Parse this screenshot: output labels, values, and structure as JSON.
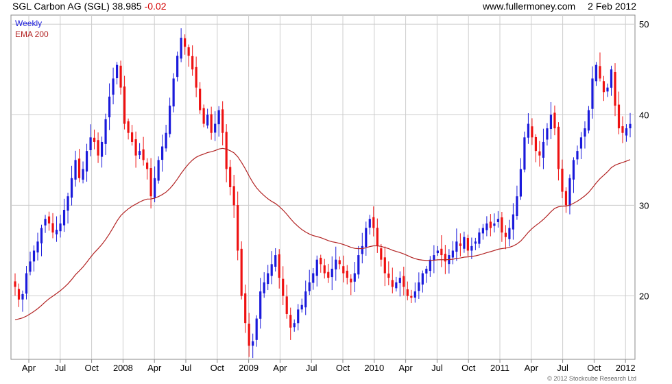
{
  "header": {
    "title": "SGL Carbon AG (SGL)",
    "last": "38.985",
    "change": "-0.02",
    "source": "www.fullermoney.com",
    "date": "2 Feb 2012"
  },
  "colors": {
    "up": "#1a1adb",
    "down": "#ee1111",
    "ema": "#b22222",
    "grid": "#cccccc",
    "frame": "#888888"
  },
  "chart_data": {
    "type": "candlestick",
    "interval": "Weekly",
    "overlay": "EMA 200",
    "x_tick_labels": [
      "Apr",
      "Jul",
      "Oct",
      "2008",
      "Apr",
      "Jul",
      "Oct",
      "2009",
      "Apr",
      "Jul",
      "Oct",
      "2010",
      "Apr",
      "Jul",
      "Oct",
      "2011",
      "Apr",
      "Jul",
      "Oct",
      "2012"
    ],
    "y_ticks": [
      20,
      30,
      40,
      50
    ],
    "ylim": [
      13,
      51
    ],
    "grid": true,
    "legend": "top-left",
    "copyright": "© 2012 Stockcube Research Ltd",
    "closes": [
      21.0,
      19.6,
      20.2,
      22.5,
      23.8,
      25.0,
      26.0,
      27.5,
      28.5,
      28.0,
      27.0,
      27.3,
      28.0,
      29.5,
      31.0,
      33.0,
      35.0,
      33.0,
      34.0,
      36.0,
      37.5,
      37.0,
      35.5,
      37.0,
      39.5,
      42.0,
      44.0,
      45.5,
      43.0,
      39.0,
      38.0,
      37.0,
      35.5,
      36.0,
      35.0,
      34.0,
      31.0,
      33.0,
      35.0,
      36.5,
      38.0,
      41.0,
      44.0,
      46.5,
      48.5,
      47.5,
      46.5,
      45.0,
      43.0,
      40.5,
      39.0,
      40.0,
      38.0,
      39.0,
      40.5,
      38.0,
      34.0,
      32.0,
      30.0,
      25.0,
      20.0,
      17.0,
      14.5,
      15.0,
      17.5,
      20.5,
      21.5,
      22.5,
      23.5,
      24.5,
      22.0,
      20.0,
      18.0,
      16.5,
      17.0,
      18.5,
      19.0,
      20.5,
      21.5,
      22.5,
      24.0,
      23.5,
      22.5,
      22.0,
      23.0,
      24.0,
      23.5,
      22.5,
      22.0,
      21.5,
      22.5,
      24.5,
      25.5,
      27.5,
      28.5,
      27.5,
      25.5,
      24.0,
      22.5,
      22.0,
      21.0,
      21.5,
      22.0,
      21.0,
      20.0,
      19.8,
      20.5,
      21.5,
      22.5,
      23.0,
      24.0,
      24.5,
      25.0,
      24.5,
      23.8,
      24.5,
      25.0,
      26.0,
      25.5,
      26.5,
      25.0,
      25.5,
      26.0,
      27.0,
      27.5,
      28.0,
      27.5,
      28.0,
      28.5,
      27.0,
      26.5,
      27.5,
      29.0,
      31.0,
      34.0,
      37.5,
      39.0,
      37.5,
      36.0,
      35.5,
      37.0,
      38.5,
      40.0,
      38.5,
      34.0,
      31.5,
      30.0,
      33.0,
      35.0,
      36.0,
      37.5,
      38.5,
      40.5,
      44.0,
      45.5,
      44.0,
      42.5,
      43.0,
      45.0,
      41.0,
      38.5,
      38.0,
      38.5,
      38.985
    ]
  }
}
